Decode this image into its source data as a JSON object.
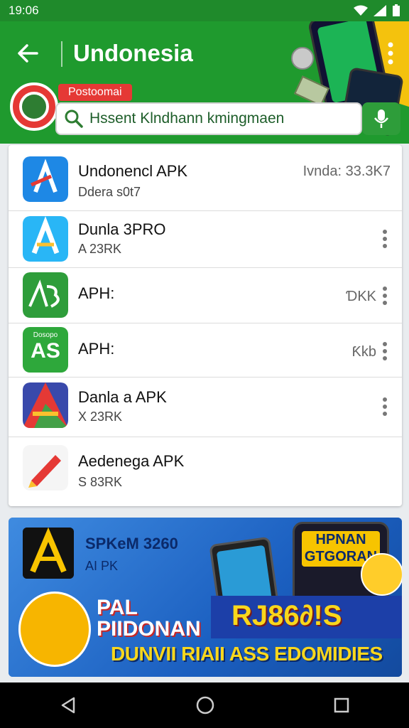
{
  "status": {
    "time": "19:06"
  },
  "header": {
    "title": "Undonesia",
    "promo": "Postoomai"
  },
  "search": {
    "value": "Hssent Klndhann kmingmaen"
  },
  "apps": [
    {
      "name": "Undonencl APK",
      "sub": "Ddera s0t7",
      "right": "Ivnda: 33.3K7"
    },
    {
      "name": "Dunla 3PRO",
      "sub": "A 23RK",
      "right": ""
    },
    {
      "name": "APH:",
      "sub": "",
      "right": "ƊKK"
    },
    {
      "name": "APH:",
      "sub": "",
      "right": "Ƙkb"
    },
    {
      "name": "Danla a APK",
      "sub": "X 23RK",
      "right": ""
    },
    {
      "name": "Aedenega APK",
      "sub": "S 83RK",
      "right": ""
    }
  ],
  "app3_badge": "Dosopo",
  "app4_text": "AS",
  "banner": {
    "line1": "SPKeM 3260",
    "line2": "AI PK",
    "phone_text": "HPNAN GTGORAN",
    "big_left": "PAL PIIDONAN",
    "big_right": "RJ86∂!S",
    "bottom": "DUNVII RIAII ASS EDOMIDIES"
  },
  "colors": {
    "header_green": "#1f9a2e",
    "banner_blue": "#1e6fd0",
    "accent_red": "#e53935",
    "accent_yellow": "#f9d71c"
  }
}
